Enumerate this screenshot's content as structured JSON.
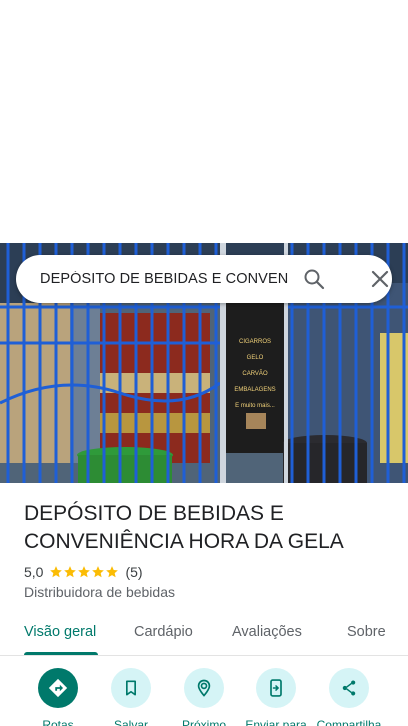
{
  "search": {
    "query": "DEPÓSITO DE BEBIDAS E CONVENIÊNCIA HORA DA GELA"
  },
  "photo": {
    "sign_lines": [
      "CIGARROS",
      "GELO",
      "CARVÃO",
      "EMBALAGENS",
      "E muito mais..."
    ]
  },
  "place": {
    "title": "DEPÓSITO DE BEBIDAS E CONVENIÊNCIA HORA DA GELA",
    "rating": "5,0",
    "stars_filled": 5,
    "review_count": "(5)",
    "category": "Distribuidora de bebidas"
  },
  "tabs": [
    {
      "label": "Visão geral",
      "active": true
    },
    {
      "label": "Cardápio",
      "active": false
    },
    {
      "label": "Avaliações",
      "active": false
    },
    {
      "label": "Sobre",
      "active": false
    }
  ],
  "actions": [
    {
      "label": "Rotas",
      "icon": "directions-icon",
      "primary": true
    },
    {
      "label": "Salvar",
      "icon": "bookmark-icon",
      "primary": false
    },
    {
      "label": "Próximo",
      "icon": "nearby-icon",
      "primary": false
    },
    {
      "label": "Enviar para",
      "icon": "send-to-phone-icon",
      "primary": false
    },
    {
      "label": "Compartilha",
      "icon": "share-icon",
      "primary": false
    }
  ],
  "colors": {
    "accent": "#00796b",
    "action_bg": "#d5f4f6",
    "star": "#fbbc04"
  }
}
